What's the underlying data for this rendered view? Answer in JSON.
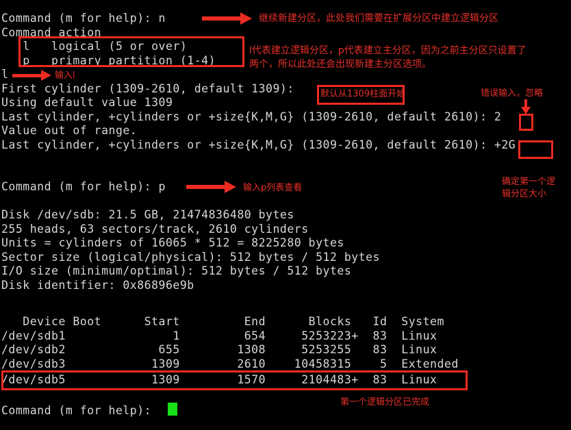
{
  "terminal": {
    "background": "#000000",
    "foreground": "#d8d8d8",
    "cursor_color": "#16e016",
    "annotation_color": "#ee2b22",
    "lines": {
      "l01": "Command (m for help): n",
      "l02": "Command action",
      "l03": "   l   logical (5 or over)",
      "l04": "   p   primary partition (1-4)",
      "l05": "l",
      "l06": "First cylinder (1309-2610, default 1309):",
      "l07": "Using default value 1309",
      "l08": "Last cylinder, +cylinders or +size{K,M,G} (1309-2610, default 2610): 2",
      "l09": "Value out of range.",
      "l10": "Last cylinder, +cylinders or +size{K,M,G} (1309-2610, default 2610): +2G",
      "l11": "Command (m for help): p",
      "l12": "Disk /dev/sdb: 21.5 GB, 21474836480 bytes",
      "l13": "255 heads, 63 sectors/track, 2610 cylinders",
      "l14": "Units = cylinders of 16065 * 512 = 8225280 bytes",
      "l15": "Sector size (logical/physical): 512 bytes / 512 bytes",
      "l16": "I/O size (minimum/optimal): 512 bytes / 512 bytes",
      "l17": "Disk identifier: 0x86896e9b",
      "l18": "Command (m for help):"
    }
  },
  "partition_table": {
    "headers": [
      "Device Boot",
      "Start",
      "End",
      "Blocks",
      "Id",
      "System"
    ],
    "header_line": "   Device Boot      Start         End      Blocks   Id  System",
    "rows": [
      {
        "line": "/dev/sdb1               1         654     5253223+  83  Linux",
        "device": "/dev/sdb1",
        "boot": "",
        "start": "1",
        "end": "654",
        "blocks": "5253223+",
        "id": "83",
        "system": "Linux"
      },
      {
        "line": "/dev/sdb2             655        1308     5253255   83  Linux",
        "device": "/dev/sdb2",
        "boot": "",
        "start": "655",
        "end": "1308",
        "blocks": "5253255",
        "id": "83",
        "system": "Linux"
      },
      {
        "line": "/dev/sdb3            1309        2610    10458315    5  Extended",
        "device": "/dev/sdb3",
        "boot": "",
        "start": "1309",
        "end": "2610",
        "blocks": "10458315",
        "id": "5",
        "system": "Extended"
      },
      {
        "line": "/dev/sdb5            1309        1570     2104483+  83  Linux",
        "device": "/dev/sdb5",
        "boot": "",
        "start": "1309",
        "end": "1570",
        "blocks": "2104483+",
        "id": "83",
        "system": "Linux"
      }
    ]
  },
  "annotations": {
    "a1": "继续新建分区，此处我们需要在扩展分区中建立逻辑分区",
    "a2_line1": "l代表建立逻辑分区，p代表建立主分区，因为之前主分区只设置了",
    "a2_line2": "两个，所以此处还会出现新建主分区选项。",
    "a3": "输入l",
    "a4": "默认从1309柱面开始",
    "a5": "错误输入，忽略",
    "a6": "输入p列表查看",
    "a7_line1": "确定第一个逻",
    "a7_line2": "辑分区大小",
    "a8": "第一个逻辑分区已完成"
  }
}
